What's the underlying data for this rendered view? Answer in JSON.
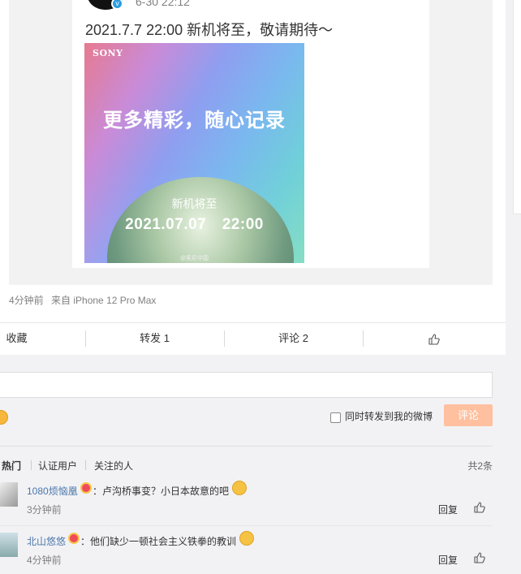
{
  "post": {
    "time": "6-30 22:12",
    "text": "2021.7.7 22:00 新机将至，敬请期待～",
    "verified_mark": "v",
    "image": {
      "brand": "SONY",
      "headline": "更多精彩，随心记录",
      "subtitle": "新机将至",
      "date": "2021.07.07　22:00",
      "watermark": "@索尼中国"
    },
    "meta_time": "4分钟前",
    "meta_source": "来自 iPhone 12 Pro Max"
  },
  "actions": {
    "favorite": "收藏",
    "repost": "转发 1",
    "comment": "评论 2"
  },
  "comment_box": {
    "input_value": "",
    "repost_checkbox_label": "同时转发到我的微博",
    "repost_checked": false,
    "submit_label": "评论"
  },
  "filters": {
    "hot": "热门",
    "verified": "认证用户",
    "following": "关注的人",
    "total": "共2条"
  },
  "comments": [
    {
      "user": "1080烦恼凰",
      "text": "：卢沟桥事变？小日本故意的吧",
      "time": "3分钟前",
      "reply_label": "回复"
    },
    {
      "user": "北山悠悠",
      "text": "：他们缺少一顿社会主义铁拳的教训",
      "time": "4分钟前",
      "reply_label": "回复"
    }
  ],
  "colors": {
    "accent_orange": "#eb7350",
    "link_blue": "#4a76a8",
    "button_disabled": "#ffc09f"
  }
}
